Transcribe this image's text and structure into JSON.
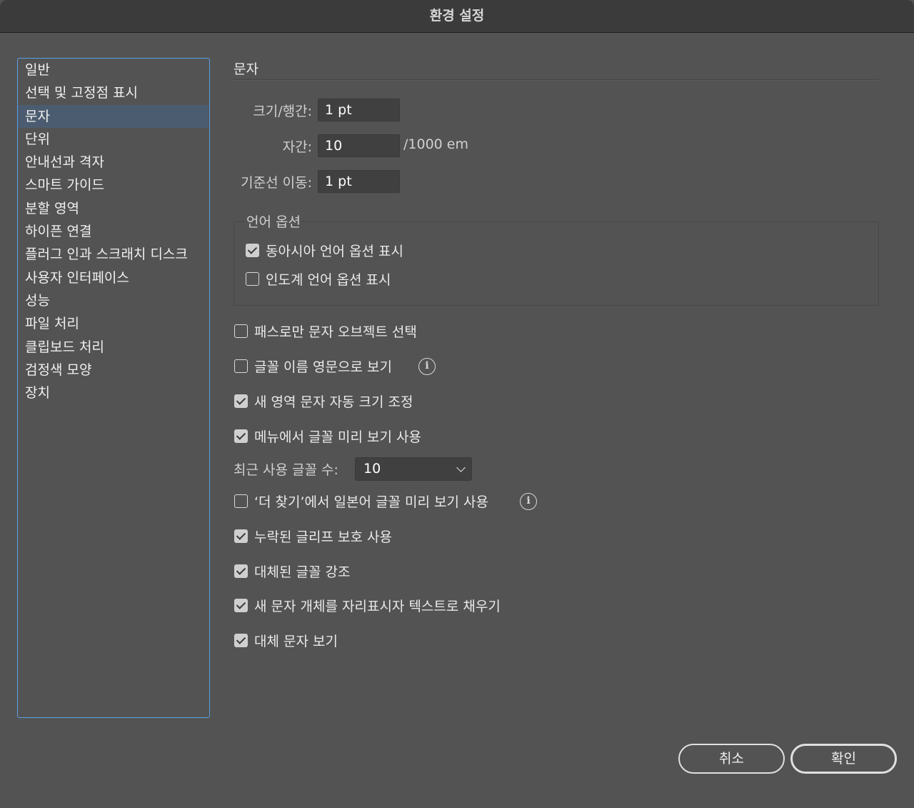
{
  "window": {
    "title": "환경 설정"
  },
  "sidebar": {
    "items": [
      {
        "label": "일반"
      },
      {
        "label": "선택 및 고정점 표시"
      },
      {
        "label": "문자"
      },
      {
        "label": "단위"
      },
      {
        "label": "안내선과 격자"
      },
      {
        "label": "스마트 가이드"
      },
      {
        "label": "분할 영역"
      },
      {
        "label": "하이픈 연결"
      },
      {
        "label": "플러그 인과 스크래치 디스크"
      },
      {
        "label": "사용자 인터페이스"
      },
      {
        "label": "성능"
      },
      {
        "label": "파일 처리"
      },
      {
        "label": "클립보드 처리"
      },
      {
        "label": "검정색 모양"
      },
      {
        "label": "장치"
      }
    ],
    "selected": "문자"
  },
  "section": {
    "title": "문자"
  },
  "fields": {
    "size_leading": {
      "label": "크기/행간:",
      "value": "1 pt"
    },
    "tracking": {
      "label": "자간:",
      "value": "10",
      "unit": "/1000 em"
    },
    "baseline_shift": {
      "label": "기준선 이동:",
      "value": "1 pt"
    }
  },
  "language_options": {
    "title": "언어 옵션",
    "east_asian": {
      "label": "동아시아 언어 옵션 표시",
      "checked": true
    },
    "indic": {
      "label": "인도계 언어 옵션 표시",
      "checked": false
    }
  },
  "options": {
    "path_only_select": {
      "label": "패스로만 문자 오브젝트 선택",
      "checked": false
    },
    "font_names_english": {
      "label": "글꼴 이름 영문으로 보기",
      "checked": false
    },
    "auto_size_area": {
      "label": "새 영역 문자 자동 크기 조정",
      "checked": true
    },
    "menu_font_preview": {
      "label": "메뉴에서 글꼴 미리 보기 사용",
      "checked": true
    },
    "recent_fonts": {
      "label": "최근 사용 글꼴 수:",
      "value": "10"
    },
    "japanese_preview": {
      "label": "‘더 찾기’에서 일본어 글꼴 미리 보기 사용",
      "checked": false
    },
    "missing_glyph": {
      "label": "누락된 글리프 보호 사용",
      "checked": true
    },
    "highlight_substituted": {
      "label": "대체된 글꼴 강조",
      "checked": true
    },
    "fill_placeholder": {
      "label": "새 문자 개체를 자리표시자 텍스트로 채우기",
      "checked": true
    },
    "show_alternates": {
      "label": "대체 문자 보기",
      "checked": true
    }
  },
  "buttons": {
    "cancel": "취소",
    "ok": "확인"
  }
}
